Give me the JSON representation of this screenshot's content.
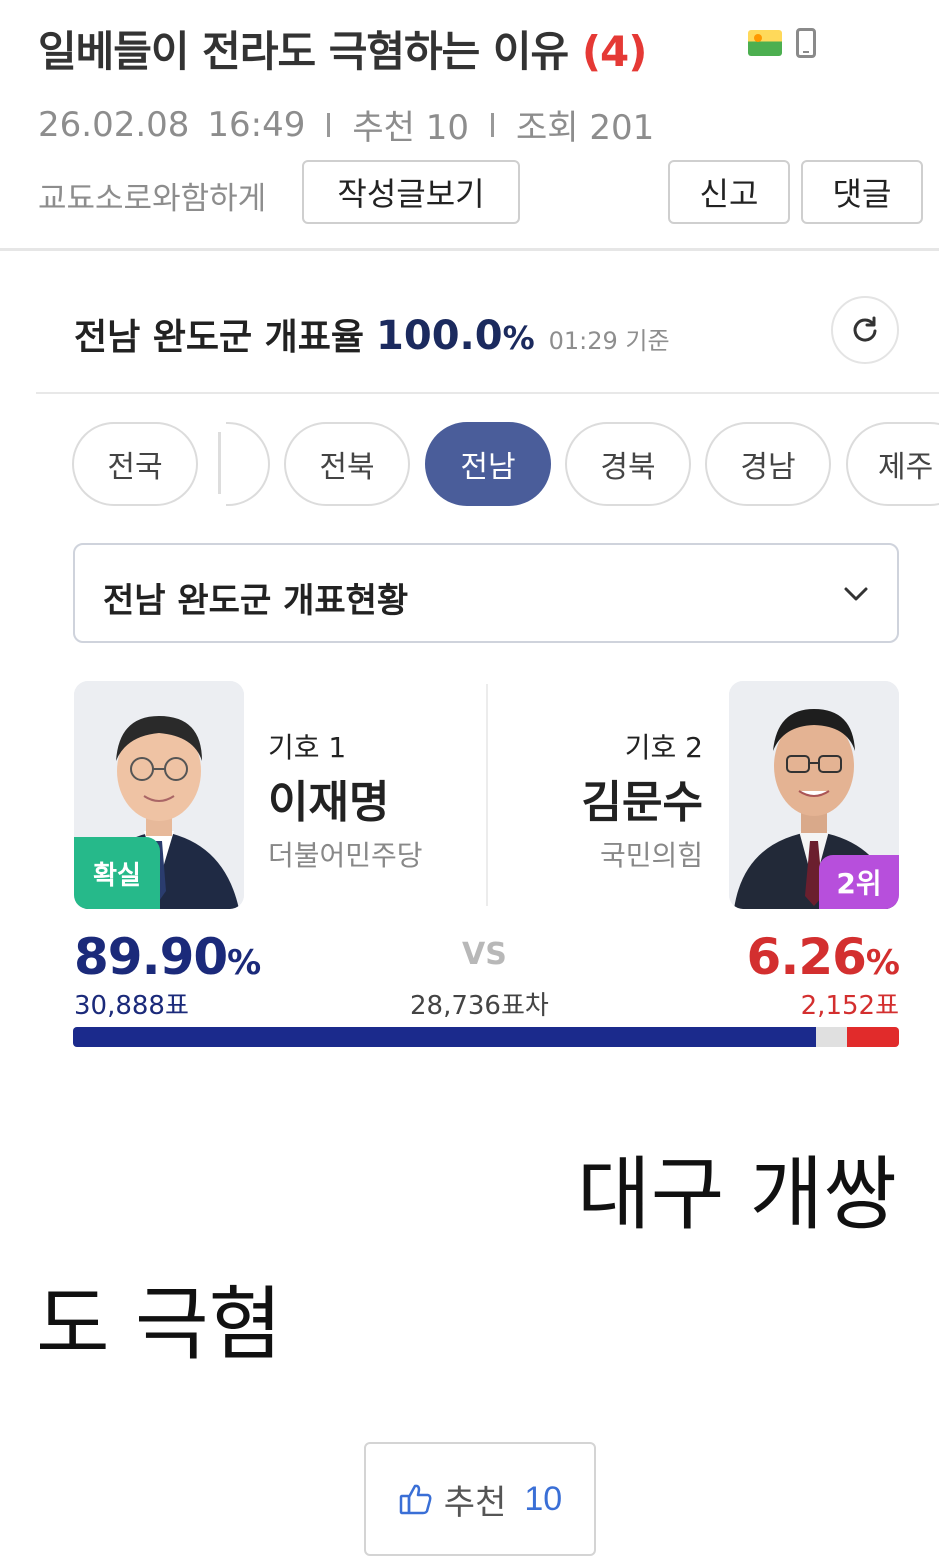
{
  "post": {
    "title": "일베들이 전라도 극혐하는 이유",
    "comment_count": "(4)",
    "icons": [
      "image-icon",
      "mobile-icon"
    ],
    "date": "26.02.08",
    "time": "16:49",
    "recommend": "추천 10",
    "views": "조회 201",
    "author": "교됴소로와함하게",
    "buttons": {
      "author_posts": "작성글보기",
      "report": "신고",
      "comment": "댓글"
    },
    "body_lines": [
      "대구 개쌍",
      "도 극혐"
    ],
    "like_button": {
      "label": "추천",
      "count": "10"
    }
  },
  "election": {
    "header": {
      "region": "전남 완도군 개표율",
      "rate": "100.0",
      "rate_unit": "%",
      "timestamp": "01:29 기준"
    },
    "region_tabs": [
      "전국",
      "전북",
      "전남",
      "경북",
      "경남",
      "제주"
    ],
    "active_tab": "전남",
    "dropdown_label": "전남 완도군 개표현황",
    "candidates": [
      {
        "number_label": "기호 1",
        "name": "이재명",
        "party": "더불어민주당",
        "badge": "확실",
        "percent": "89.90",
        "votes": "30,888표",
        "color": "#1b2a8c"
      },
      {
        "number_label": "기호 2",
        "name": "김문수",
        "party": "국민의힘",
        "badge": "2위",
        "percent": "6.26",
        "votes": "2,152표",
        "color": "#e12b2b"
      }
    ],
    "vs_label": "VS",
    "vote_difference": "28,736표차",
    "bar_shares": {
      "left": 89.9,
      "right": 6.26
    }
  },
  "colors": {
    "accent_blue": "#1b2a7a",
    "accent_red": "#d32f2f",
    "active_tab": "#4a5d9a",
    "win_badge": "#26b98a",
    "rank_badge": "#b74fdc",
    "like_count": "#3a6fd6"
  }
}
